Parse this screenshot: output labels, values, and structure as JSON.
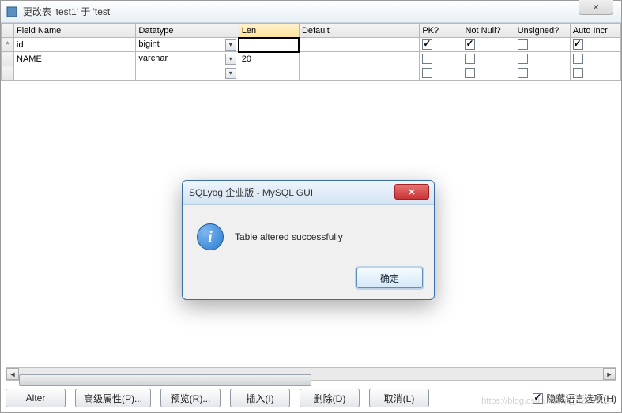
{
  "window": {
    "title": "更改表 'test1' 于 'test'"
  },
  "columns": {
    "field_name": "Field Name",
    "datatype": "Datatype",
    "len": "Len",
    "default": "Default",
    "pk": "PK?",
    "not_null": "Not Null?",
    "unsigned": "Unsigned?",
    "auto_inc": "Auto Incr"
  },
  "rows": [
    {
      "marker": "*",
      "field_name": "id",
      "datatype": "bigint",
      "len": "",
      "default": "",
      "pk": true,
      "not_null": true,
      "unsigned": false,
      "auto_inc": true,
      "selected": true
    },
    {
      "marker": "",
      "field_name": "NAME",
      "datatype": "varchar",
      "len": "20",
      "default": "",
      "pk": false,
      "not_null": false,
      "unsigned": false,
      "auto_inc": false,
      "selected": false
    },
    {
      "marker": "",
      "field_name": "",
      "datatype": "",
      "len": "",
      "default": "",
      "pk": false,
      "not_null": false,
      "unsigned": false,
      "auto_inc": false,
      "selected": false
    }
  ],
  "buttons": {
    "alter": "Alter",
    "advanced": "高级属性(P)...",
    "preview": "预览(R)...",
    "insert": "插入(I)",
    "delete": "删除(D)",
    "cancel": "取消(L)"
  },
  "hide_lang_option": {
    "label": "隐藏语言选项(H)",
    "checked": true
  },
  "dialog": {
    "title": "SQLyog 企业版 - MySQL GUI",
    "message": "Table altered successfully",
    "ok": "确定"
  },
  "watermark": "https://blog.csdn.net/qq_42305534"
}
